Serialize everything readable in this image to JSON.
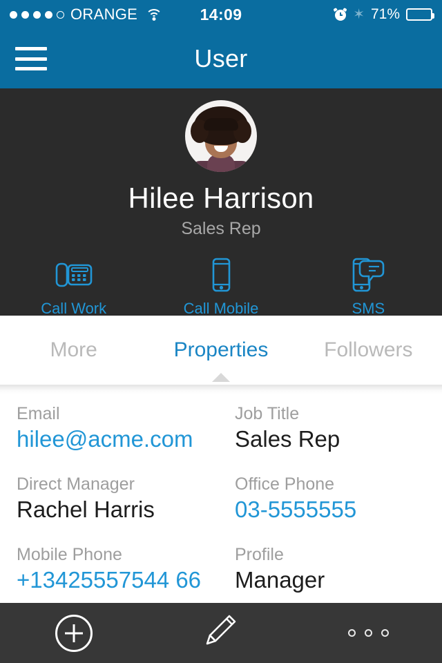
{
  "status_bar": {
    "carrier": "ORANGE",
    "signal_dots_filled": 4,
    "signal_dots_total": 5,
    "wifi_icon": "wifi-icon",
    "time": "14:09",
    "alarm_icon": "alarm-clock-icon",
    "bluetooth_icon": "bluetooth-icon",
    "bluetooth_glyph": "✶",
    "battery_percent": "71%",
    "battery_level": 71
  },
  "nav_bar": {
    "menu_icon": "hamburger-menu-icon",
    "title": "User"
  },
  "profile": {
    "avatar_icon": "user-avatar-photo",
    "name": "Hilee Harrison",
    "subtitle": "Sales Rep",
    "actions": [
      {
        "id": "call-work",
        "label": "Call Work",
        "icon": "desk-phone-icon"
      },
      {
        "id": "call-mobile",
        "label": "Call Mobile",
        "icon": "mobile-phone-icon"
      },
      {
        "id": "sms",
        "label": "SMS",
        "icon": "sms-chat-icon"
      }
    ]
  },
  "tabs": [
    {
      "id": "more",
      "label": "More",
      "active": false
    },
    {
      "id": "properties",
      "label": "Properties",
      "active": true
    },
    {
      "id": "followers",
      "label": "Followers",
      "active": false
    }
  ],
  "properties": [
    [
      {
        "label": "Email",
        "value": "hilee@acme.com",
        "is_link": true
      },
      {
        "label": "Job Title",
        "value": "Sales Rep",
        "is_link": false
      }
    ],
    [
      {
        "label": "Direct Manager",
        "value": "Rachel Harris",
        "is_link": false
      },
      {
        "label": "Office Phone",
        "value": "03-5555555",
        "is_link": true
      }
    ],
    [
      {
        "label": "Mobile Phone",
        "value": "+13425557544 66",
        "is_link": true
      },
      {
        "label": "Profile",
        "value": "Manager",
        "is_link": false
      }
    ]
  ],
  "toolbar": [
    {
      "id": "add",
      "icon": "plus-circle-icon"
    },
    {
      "id": "edit",
      "icon": "pencil-edit-icon"
    },
    {
      "id": "more",
      "icon": "three-dots-more-icon"
    }
  ],
  "colors": {
    "nav_blue": "#0a6da0",
    "accent_blue": "#2196d6",
    "tab_active_blue": "#1a85c4",
    "header_dark": "#2b2b2b",
    "label_gray": "#9e9e9e",
    "toolbar_dark": "#282828"
  }
}
